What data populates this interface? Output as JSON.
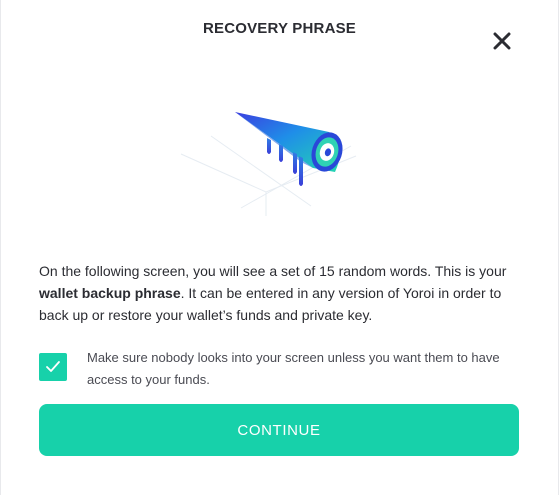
{
  "dialog": {
    "title": "RECOVERY PHRASE",
    "close_icon": "close-icon",
    "illustration": "recovery-phrase-illustration"
  },
  "body": {
    "text_before": "On the following screen, you will see a set of 15 random words. This is your ",
    "text_bold": "wallet backup phrase",
    "text_after": ". It can be entered in any version of Yoroi in order to back up or restore your wallet’s funds and private key."
  },
  "acknowledgement": {
    "checked": true,
    "label": "Make sure nobody looks into your screen unless you want them to have access to your funds."
  },
  "continue_button": {
    "label": "CONTINUE"
  },
  "colors": {
    "accent": "#17d1aa",
    "text": "#2b2c32",
    "secondary_text": "#4a4b53"
  }
}
